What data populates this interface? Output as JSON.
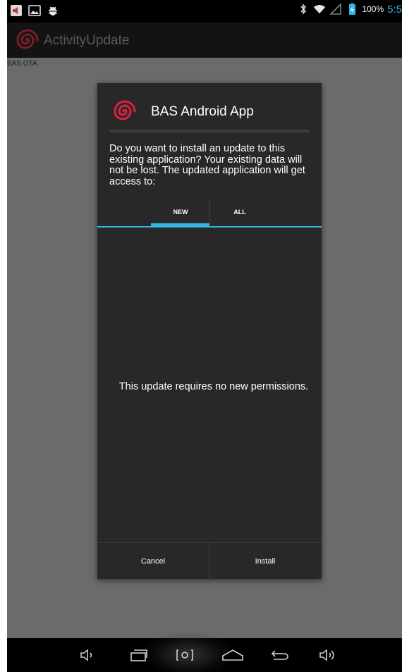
{
  "status_bar": {
    "battery_text": "100%",
    "time": "5:5"
  },
  "action_bar": {
    "title": "ActivityUpdate"
  },
  "content": {
    "label": "BAS OTA"
  },
  "dialog": {
    "title": "BAS Android App",
    "message": "Do you want to install an update to this existing application? Your existing data will not be lost. The updated application will get access to:",
    "tabs": [
      {
        "label": "NEW",
        "selected": true
      },
      {
        "label": "ALL",
        "selected": false
      }
    ],
    "permissions_message": "This update requires no new permissions.",
    "buttons": {
      "cancel": "Cancel",
      "install": "Install"
    }
  },
  "colors": {
    "accent": "#33b5e5",
    "dialog_bg": "#282828",
    "logo_red": "#e0203c"
  },
  "icons": {
    "status_left": [
      "sound-notification-icon",
      "image-notification-icon",
      "android-debug-icon"
    ],
    "status_right": [
      "bluetooth-icon",
      "wifi-icon",
      "signal-icon",
      "battery-charging-icon"
    ],
    "nav": [
      "volume-down-icon",
      "recent-apps-icon",
      "screenshot-icon",
      "home-icon",
      "back-icon",
      "volume-up-icon"
    ]
  }
}
